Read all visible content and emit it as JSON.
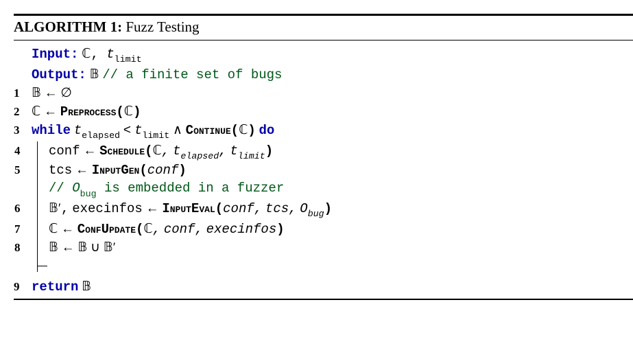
{
  "header": {
    "label": "ALGORITHM 1:",
    "title": "Fuzz Testing"
  },
  "io": {
    "input_kw": "Input:",
    "input_C": "ℂ",
    "input_t": "t",
    "input_t_sub": "limit",
    "output_kw": "Output:",
    "output_B": "𝔹",
    "output_comment": "// a finite set of bugs"
  },
  "lines": {
    "l1": {
      "n": "1",
      "B": "𝔹",
      "arrow": "←",
      "empty": "∅"
    },
    "l2": {
      "n": "2",
      "C": "ℂ",
      "arrow": "←",
      "fn": "Preprocess(",
      "C2": "ℂ",
      "close": ")"
    },
    "l3": {
      "n": "3",
      "while": "while",
      "t": "t",
      "tsub": "elapsed",
      "lt": "<",
      "t2": "t",
      "t2sub": "limit",
      "and": "∧",
      "fn": "Continue(",
      "C": "ℂ",
      "close": ")",
      "do": "do"
    },
    "l4": {
      "n": "4",
      "conf": "conf",
      "arrow": "←",
      "fn": "Schedule(",
      "C": "ℂ",
      "comma1": ",",
      "t1": "t",
      "t1sub": "elapsed",
      "comma2": ",",
      "t2": "t",
      "t2sub": "limit",
      "close": ")"
    },
    "l5": {
      "n": "5",
      "tcs": "tcs",
      "arrow": "←",
      "fn": "InputGen(",
      "conf": "conf",
      "close": ")"
    },
    "lcomment": {
      "text1": "// ",
      "O": "O",
      "Osub": "bug",
      "text2": " is embedded in a fuzzer"
    },
    "l6": {
      "n": "6",
      "Bp": "𝔹′",
      "comma": ",",
      "exec": "execinfos",
      "arrow": "←",
      "fn": "InputEval(",
      "conf": "conf",
      "c1": ",",
      "tcs": "tcs",
      "c2": ",",
      "O": "O",
      "Osub": "bug",
      "close": ")"
    },
    "l7": {
      "n": "7",
      "C": "ℂ",
      "arrow": "←",
      "fn": "ConfUpdate(",
      "C2": "ℂ",
      "c1": ",",
      "conf": "conf",
      "c2": ",",
      "exec": "execinfos",
      "close": ")"
    },
    "l8": {
      "n": "8",
      "B": "𝔹",
      "arrow": "←",
      "B2": "𝔹",
      "cup": "∪",
      "Bp": "𝔹′"
    },
    "l9": {
      "n": "9",
      "return": "return",
      "B": "𝔹"
    }
  }
}
